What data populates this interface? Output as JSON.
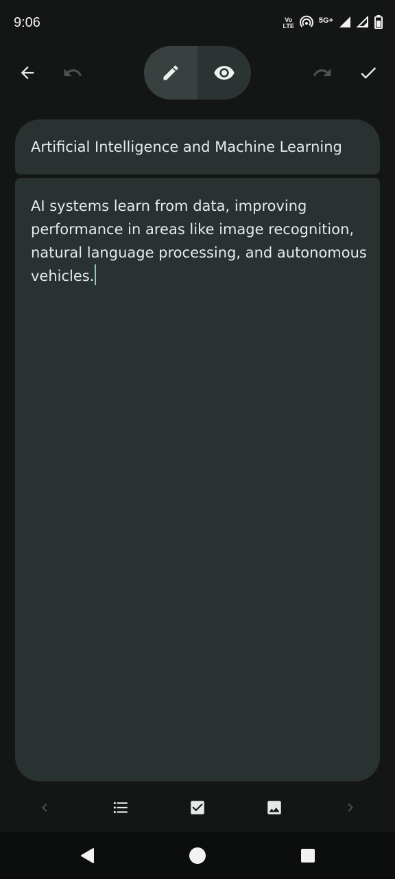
{
  "status_bar": {
    "time": "9:06",
    "volte_line1": "Vo",
    "volte_line2": "LTE",
    "network": "5G+"
  },
  "toolbar": {
    "back_icon": "arrow-left-icon",
    "undo_icon": "undo-icon",
    "edit_mode_icon": "pencil-icon",
    "preview_mode_icon": "eye-icon",
    "redo_icon": "redo-icon",
    "done_icon": "check-icon",
    "active_mode": "edit"
  },
  "note": {
    "title": "Artificial Intelligence and Machine Learning",
    "body": "AI systems learn from data, improving performance in areas like image recognition, natural language processing, and autonomous vehicles."
  },
  "format_bar": {
    "icons": [
      "chevron-left-icon",
      "bulleted-list-icon",
      "checkbox-icon",
      "image-icon",
      "chevron-right-icon"
    ]
  },
  "nav_bar": {
    "icons": [
      "back-triangle-icon",
      "home-circle-icon",
      "recents-square-icon"
    ]
  },
  "colors": {
    "background": "#141616",
    "card": "#2a3131",
    "toggle": "#2b3333",
    "cursor": "#7fd3c3"
  }
}
